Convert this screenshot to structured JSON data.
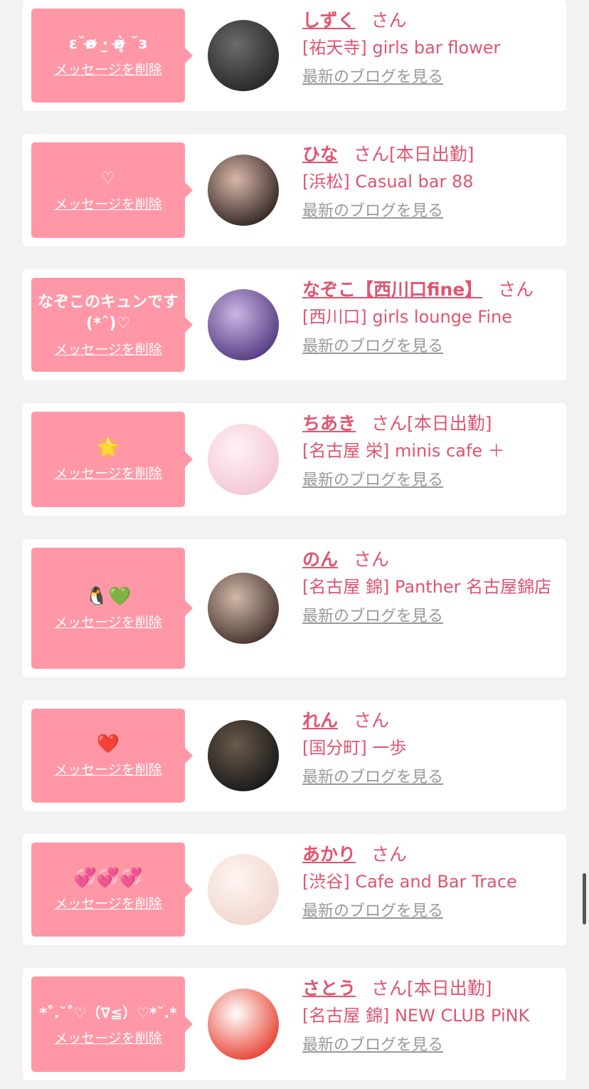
{
  "delete_label": "メッセージを削除",
  "san_label": "さん",
  "blog_label": "最新のブログを見る",
  "cards": [
    {
      "message": "ε˘ʚ̴̶̷̷ ·̫ ʚ̴̶̷̥̀ ˘з",
      "emoji": false,
      "name": "しずく",
      "status": "",
      "shop": "[祐天寺] girls bar flower",
      "avatar_colors": [
        "#2a2a2a",
        "#6b6b6b"
      ]
    },
    {
      "message": "♡",
      "emoji": false,
      "name": "ひな",
      "status": "[本日出勤]",
      "shop": "[浜松] Casual bar 88",
      "avatar_colors": [
        "#3a2c2a",
        "#d9b8a8"
      ]
    },
    {
      "message": "なぞこのキュンです(*ˆ)♡",
      "emoji": false,
      "name": "なぞこ【西川口fine】",
      "status": "",
      "shop": "[西川口] girls lounge Fine",
      "avatar_colors": [
        "#5a3f86",
        "#c9b6e4"
      ]
    },
    {
      "message": "🌟",
      "emoji": true,
      "name": "ちあき",
      "status": "[本日出勤]",
      "shop": "[名古屋 栄] minis cafe ＋",
      "avatar_colors": [
        "#f4c9d6",
        "#fff1f4"
      ]
    },
    {
      "message": "🐧💚",
      "emoji": true,
      "name": "のん",
      "status": "",
      "shop": "[名古屋 錦] Panther 名古屋錦店",
      "avatar_colors": [
        "#4a3a33",
        "#d2b8a8"
      ]
    },
    {
      "message": "❤️",
      "emoji": true,
      "name": "れん",
      "status": "",
      "shop": "[国分町] 一歩",
      "avatar_colors": [
        "#1c1c1c",
        "#6a5a4a"
      ]
    },
    {
      "message": "💞💞💞",
      "emoji": true,
      "name": "あかり",
      "status": "",
      "shop": "[渋谷] Cafe and Bar Trace",
      "avatar_colors": [
        "#f0d8cf",
        "#fff5f2"
      ]
    },
    {
      "message": "*˚.˘˚♡（∇≦）♡*˘.*",
      "emoji": false,
      "name": "さとう",
      "status": "[本日出勤]",
      "shop": "[名古屋 錦] NEW CLUB PiNK",
      "avatar_colors": [
        "#e84a3b",
        "#ffffff"
      ]
    }
  ]
}
